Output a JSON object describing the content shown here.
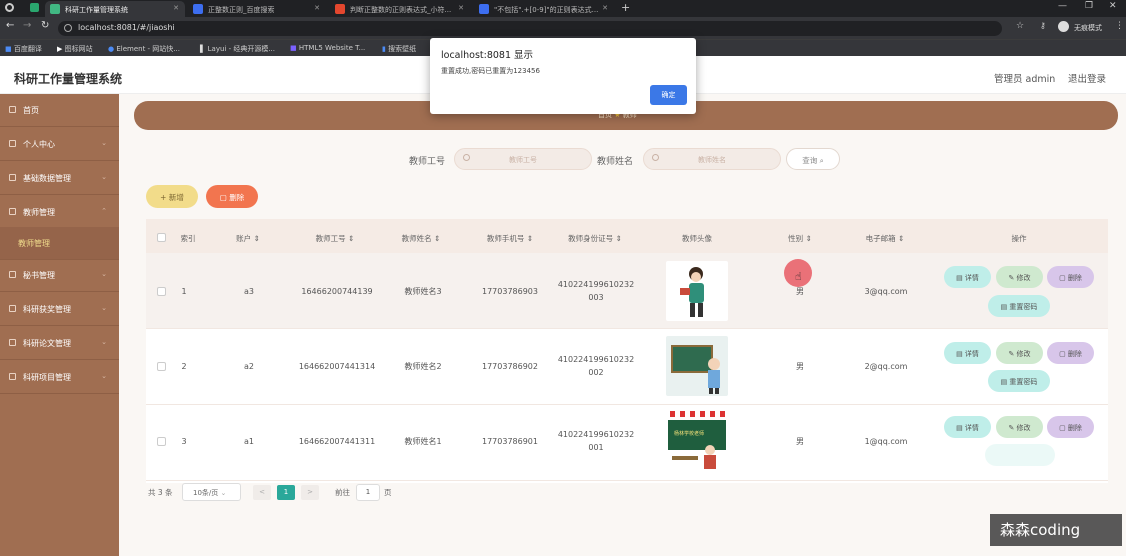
{
  "browser": {
    "tabs": [
      {
        "label": "科研工作量管理系统",
        "active": true
      },
      {
        "label": "正整数正则_百度搜索",
        "active": false
      },
      {
        "label": "判断正整数的正则表达式_小符...",
        "active": false
      },
      {
        "label": "\"不包括\".+[0-9]\"的正则表达式...",
        "active": false
      }
    ],
    "url": "localhost:8081/#/jiaoshi",
    "profile": "无痕模式",
    "bookmarks": [
      "百度翻译",
      "图标网站",
      "Element - 网站快...",
      "Layui - 经典开源模...",
      "HTML5 Website T...",
      "搜索壁纸"
    ]
  },
  "app": {
    "title": "科研工作量管理系统",
    "admin": "管理员 admin",
    "logout": "退出登录"
  },
  "sidebar": {
    "items": [
      {
        "label": "首页"
      },
      {
        "label": "个人中心"
      },
      {
        "label": "基础数据管理"
      },
      {
        "label": "教师管理"
      },
      {
        "label": "教师管理"
      },
      {
        "label": "秘书管理"
      },
      {
        "label": "科研获奖管理"
      },
      {
        "label": "科研论文管理"
      },
      {
        "label": "科研项目管理"
      }
    ]
  },
  "breadcrumb": {
    "home": "首页",
    "current": "教师"
  },
  "search": {
    "label1": "教师工号",
    "placeholder1": "教师工号",
    "label2": "教师姓名",
    "placeholder2": "教师姓名",
    "button": "查询"
  },
  "actions": {
    "add": "新增",
    "delete": "删除"
  },
  "table": {
    "headers": [
      "索引",
      "账户",
      "教师工号",
      "教师姓名",
      "教师手机号",
      "教师身份证号",
      "教师头像",
      "性别",
      "电子邮箱",
      "操作"
    ],
    "rows": [
      {
        "index": "1",
        "account": "a3",
        "id": "16466200744139",
        "name": "教师姓名3",
        "phone": "17703786903",
        "idcard1": "410224199610232",
        "idcard2": "003",
        "gender": "男",
        "email": "3@qq.com"
      },
      {
        "index": "2",
        "account": "a2",
        "id": "164662007441314",
        "name": "教师姓名2",
        "phone": "17703786902",
        "idcard1": "410224199610232",
        "idcard2": "002",
        "gender": "男",
        "email": "2@qq.com"
      },
      {
        "index": "3",
        "account": "a1",
        "id": "164662007441311",
        "name": "教师姓名1",
        "phone": "17703786901",
        "idcard1": "410224199610232",
        "idcard2": "001",
        "gender": "男",
        "email": "1@qq.com"
      }
    ],
    "row_buttons": {
      "detail": "详情",
      "edit": "修改",
      "delete": "删除",
      "reset": "重置密码"
    },
    "avatar_caption": "杨林学校老师"
  },
  "pagination": {
    "total": "共 3 条",
    "page_size": "10条/页",
    "page": "1",
    "goto": "前往",
    "goto_value": "1",
    "goto_suffix": "页",
    "prev": "<",
    "next": ">"
  },
  "dialog": {
    "title": "localhost:8081 显示",
    "message": "重置成功,密码已重置为123456",
    "ok": "确定"
  },
  "watermark": "森森coding",
  "colors": {
    "sidebar": "#a06e51",
    "accent_primary": "#3b78e7",
    "add_button": "#f2dc8a",
    "delete_button": "#f2754f"
  }
}
